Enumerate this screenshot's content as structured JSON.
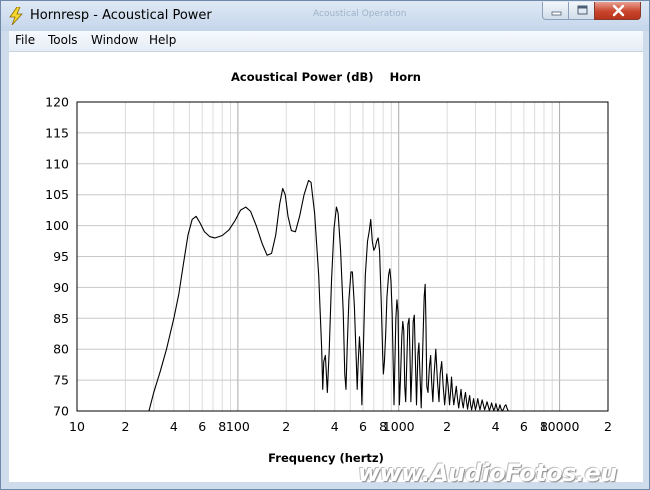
{
  "window": {
    "title": "Hornresp - Acoustical Power",
    "ghost_title": "Acoustical Operation"
  },
  "menu": {
    "items": [
      {
        "label": "File"
      },
      {
        "label": "Tools"
      },
      {
        "label": "Window"
      },
      {
        "label": "Help"
      }
    ]
  },
  "watermark": "www.AudioFotos.eu",
  "chart_data": {
    "type": "line",
    "title": "Acoustical Power (dB)    Horn",
    "xlabel": "Frequency (hertz)",
    "ylabel": "",
    "x_scale": "log",
    "xlim": [
      10,
      20000
    ],
    "ylim": [
      70,
      120
    ],
    "y_ticks": [
      "70",
      "75",
      "80",
      "85",
      "90",
      "95",
      "100",
      "105",
      "110",
      "115",
      "120"
    ],
    "x_ticks": [
      {
        "value": 10,
        "label": "10"
      },
      {
        "value": 20,
        "label": "2"
      },
      {
        "value": 40,
        "label": "4"
      },
      {
        "value": 60,
        "label": "6"
      },
      {
        "value": 80,
        "label": "8"
      },
      {
        "value": 100,
        "label": "100"
      },
      {
        "value": 200,
        "label": "2"
      },
      {
        "value": 400,
        "label": "4"
      },
      {
        "value": 600,
        "label": "6"
      },
      {
        "value": 800,
        "label": "8"
      },
      {
        "value": 1000,
        "label": "1000"
      },
      {
        "value": 2000,
        "label": "2"
      },
      {
        "value": 4000,
        "label": "4"
      },
      {
        "value": 6000,
        "label": "6"
      },
      {
        "value": 8000,
        "label": "8"
      },
      {
        "value": 10000,
        "label": "10000"
      },
      {
        "value": 20000,
        "label": "2"
      }
    ],
    "grid": true,
    "series": [
      {
        "color": "#000000",
        "points": [
          [
            28,
            70
          ],
          [
            30,
            73
          ],
          [
            33,
            76.5
          ],
          [
            36,
            80
          ],
          [
            40,
            85
          ],
          [
            43,
            89
          ],
          [
            46,
            94
          ],
          [
            49,
            98.5
          ],
          [
            52,
            101
          ],
          [
            55,
            101.5
          ],
          [
            58,
            100.5
          ],
          [
            62,
            99
          ],
          [
            67,
            98.2
          ],
          [
            72,
            98
          ],
          [
            80,
            98.4
          ],
          [
            88,
            99.3
          ],
          [
            96,
            100.8
          ],
          [
            104,
            102.5
          ],
          [
            112,
            103
          ],
          [
            120,
            102.3
          ],
          [
            130,
            100
          ],
          [
            142,
            97
          ],
          [
            152,
            95.2
          ],
          [
            162,
            95.5
          ],
          [
            172,
            98.5
          ],
          [
            182,
            103.5
          ],
          [
            190,
            106
          ],
          [
            197,
            105
          ],
          [
            205,
            101.5
          ],
          [
            215,
            99.2
          ],
          [
            228,
            99
          ],
          [
            242,
            101.5
          ],
          [
            258,
            105
          ],
          [
            275,
            107.3
          ],
          [
            285,
            107
          ],
          [
            300,
            102
          ],
          [
            318,
            92
          ],
          [
            332,
            80
          ],
          [
            337,
            73.5
          ],
          [
            342,
            78
          ],
          [
            350,
            79
          ],
          [
            360,
            73
          ],
          [
            370,
            80
          ],
          [
            382,
            91
          ],
          [
            396,
            99.5
          ],
          [
            410,
            103
          ],
          [
            420,
            102
          ],
          [
            435,
            96
          ],
          [
            452,
            86
          ],
          [
            462,
            76
          ],
          [
            470,
            73.5
          ],
          [
            478,
            80
          ],
          [
            490,
            88
          ],
          [
            505,
            92.5
          ],
          [
            515,
            92.5
          ],
          [
            530,
            87
          ],
          [
            545,
            78
          ],
          [
            552,
            73.5
          ],
          [
            558,
            77
          ],
          [
            570,
            82
          ],
          [
            580,
            79
          ],
          [
            590,
            71
          ],
          [
            600,
            78
          ],
          [
            620,
            92
          ],
          [
            640,
            97.5
          ],
          [
            655,
            99
          ],
          [
            670,
            101
          ],
          [
            685,
            97.5
          ],
          [
            700,
            96
          ],
          [
            715,
            96.5
          ],
          [
            730,
            97.5
          ],
          [
            745,
            98
          ],
          [
            760,
            96
          ],
          [
            780,
            87
          ],
          [
            795,
            79
          ],
          [
            803,
            76
          ],
          [
            815,
            78
          ],
          [
            830,
            82.5
          ],
          [
            845,
            88.5
          ],
          [
            865,
            92
          ],
          [
            880,
            93
          ],
          [
            895,
            91
          ],
          [
            910,
            86
          ],
          [
            925,
            77
          ],
          [
            935,
            71
          ],
          [
            945,
            77
          ],
          [
            960,
            85
          ],
          [
            975,
            88
          ],
          [
            990,
            86
          ],
          [
            1000,
            78
          ],
          [
            1010,
            71
          ],
          [
            1025,
            75
          ],
          [
            1045,
            82
          ],
          [
            1060,
            84.5
          ],
          [
            1075,
            83
          ],
          [
            1090,
            74
          ],
          [
            1105,
            71.5
          ],
          [
            1120,
            77
          ],
          [
            1140,
            84
          ],
          [
            1160,
            85
          ],
          [
            1175,
            79
          ],
          [
            1190,
            71.5
          ],
          [
            1210,
            77
          ],
          [
            1230,
            84.5
          ],
          [
            1250,
            85.5
          ],
          [
            1270,
            78
          ],
          [
            1290,
            71
          ],
          [
            1315,
            79
          ],
          [
            1335,
            81
          ],
          [
            1355,
            76
          ],
          [
            1380,
            70.5
          ],
          [
            1410,
            80
          ],
          [
            1440,
            88.5
          ],
          [
            1460,
            90.5
          ],
          [
            1475,
            85
          ],
          [
            1495,
            74
          ],
          [
            1520,
            73
          ],
          [
            1550,
            77
          ],
          [
            1580,
            79
          ],
          [
            1600,
            75
          ],
          [
            1630,
            71.5
          ],
          [
            1660,
            76
          ],
          [
            1700,
            80
          ],
          [
            1740,
            75
          ],
          [
            1780,
            71.5
          ],
          [
            1810,
            76
          ],
          [
            1850,
            78
          ],
          [
            1890,
            74
          ],
          [
            1930,
            71
          ],
          [
            1960,
            73
          ],
          [
            1990,
            76
          ],
          [
            2030,
            74
          ],
          [
            2070,
            71
          ],
          [
            2100,
            73
          ],
          [
            2130,
            75.5
          ],
          [
            2160,
            73
          ],
          [
            2200,
            71
          ],
          [
            2240,
            72.5
          ],
          [
            2280,
            74
          ],
          [
            2320,
            72
          ],
          [
            2360,
            70.5
          ],
          [
            2400,
            72
          ],
          [
            2440,
            73.5
          ],
          [
            2480,
            71.5
          ],
          [
            2520,
            70.5
          ],
          [
            2560,
            72
          ],
          [
            2600,
            73
          ],
          [
            2640,
            71.5
          ],
          [
            2680,
            70.3
          ],
          [
            2720,
            71.5
          ],
          [
            2760,
            72.5
          ],
          [
            2800,
            71
          ],
          [
            2840,
            70.2
          ],
          [
            2880,
            71
          ],
          [
            2920,
            72
          ],
          [
            2960,
            71
          ],
          [
            3000,
            70.2
          ],
          [
            3050,
            71
          ],
          [
            3100,
            72
          ],
          [
            3150,
            71
          ],
          [
            3200,
            70.2
          ],
          [
            3250,
            71
          ],
          [
            3300,
            71.8
          ],
          [
            3360,
            71
          ],
          [
            3420,
            70.2
          ],
          [
            3480,
            70.8
          ],
          [
            3540,
            71.5
          ],
          [
            3600,
            70.8
          ],
          [
            3660,
            70.1
          ],
          [
            3720,
            70.6
          ],
          [
            3780,
            71.3
          ],
          [
            3840,
            70.6
          ],
          [
            3900,
            70.1
          ],
          [
            3960,
            70.5
          ],
          [
            4020,
            71.2
          ],
          [
            4080,
            70.5
          ],
          [
            4140,
            70
          ],
          [
            4200,
            70.4
          ],
          [
            4260,
            71
          ],
          [
            4320,
            70.4
          ],
          [
            4400,
            70
          ],
          [
            4480,
            70.3
          ],
          [
            4560,
            70.8
          ],
          [
            4640,
            71
          ],
          [
            4720,
            70.4
          ],
          [
            4800,
            70
          ]
        ]
      }
    ]
  }
}
